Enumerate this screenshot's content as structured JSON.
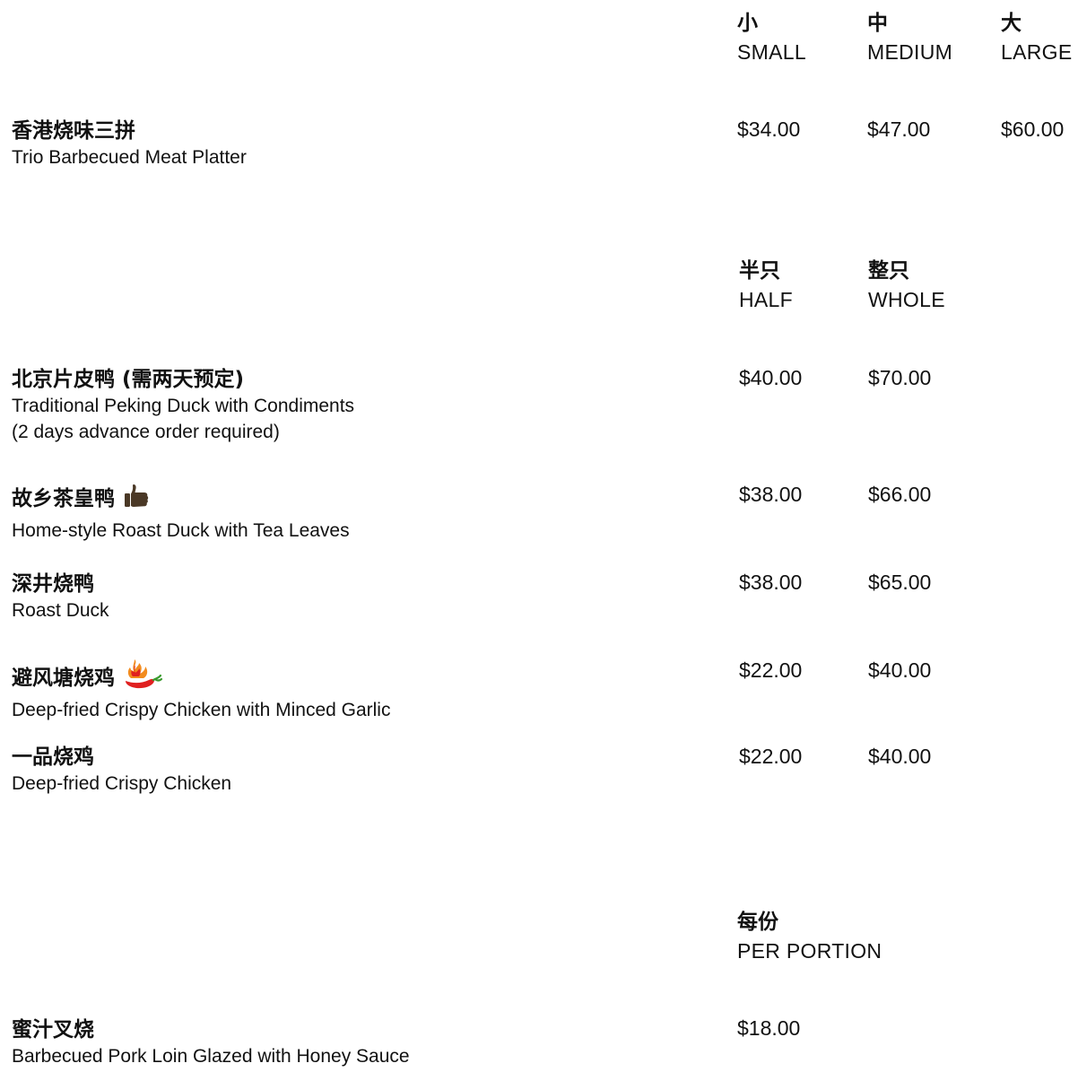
{
  "section1": {
    "headers": [
      {
        "zh": "小",
        "en": "SMALL"
      },
      {
        "zh": "中",
        "en": "MEDIUM"
      },
      {
        "zh": "大",
        "en": "LARGE"
      }
    ],
    "items": [
      {
        "zh": "香港烧味三拼",
        "en": "Trio Barbecued Meat Platter",
        "prices": [
          "$34.00",
          "$47.00",
          "$60.00"
        ]
      }
    ]
  },
  "section2": {
    "headers": [
      {
        "zh": "半只",
        "en": "HALF"
      },
      {
        "zh": "整只",
        "en": "WHOLE"
      }
    ],
    "items": [
      {
        "zh": "北京片皮鸭 (需两天预定)",
        "en": "Traditional Peking Duck with Condiments",
        "en2": "(2 days advance order required)",
        "prices": [
          "$40.00",
          "$70.00"
        ]
      },
      {
        "zh": "故乡茶皇鸭",
        "en": "Home-style Roast Duck with Tea Leaves",
        "icon": "thumbs-up-icon",
        "prices": [
          "$38.00",
          "$66.00"
        ]
      },
      {
        "zh": "深井烧鸭",
        "en": "Roast Duck",
        "prices": [
          "$38.00",
          "$65.00"
        ]
      },
      {
        "zh": "避风塘烧鸡",
        "en": "Deep-fried Crispy Chicken with Minced Garlic",
        "icon": "spicy-chili-icon",
        "prices": [
          "$22.00",
          "$40.00"
        ]
      },
      {
        "zh": "一品烧鸡",
        "en": "Deep-fried Crispy Chicken",
        "prices": [
          "$22.00",
          "$40.00"
        ]
      }
    ]
  },
  "section3": {
    "headers": [
      {
        "zh": "每份",
        "en": "PER PORTION"
      }
    ],
    "items": [
      {
        "zh": "蜜汁叉烧",
        "en": "Barbecued Pork Loin Glazed with Honey Sauce",
        "prices": [
          "$18.00"
        ]
      }
    ]
  },
  "colors": {
    "text": "#111111",
    "thumb": "#4a3826",
    "chili_red": "#e02020",
    "chili_orange": "#f28b1e",
    "chili_stem": "#3a9a2e"
  }
}
